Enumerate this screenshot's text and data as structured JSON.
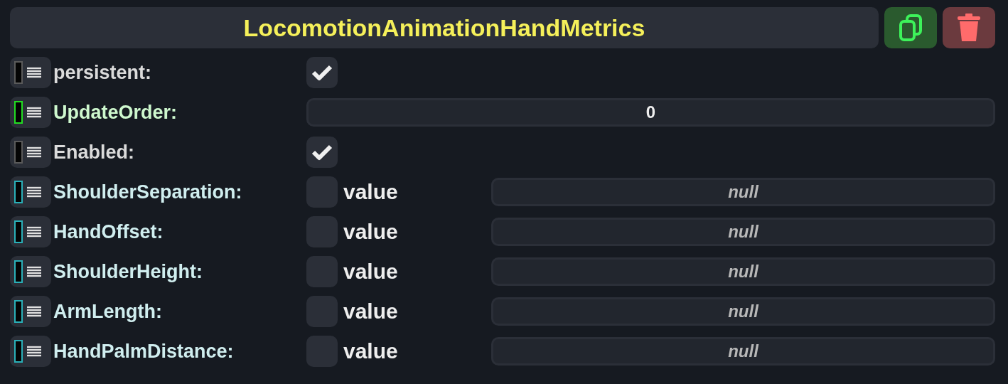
{
  "header": {
    "title": "LocomotionAnimationHandMetrics"
  },
  "fields": [
    {
      "kind": "checkbox",
      "name": "persistent:",
      "color": "#5a5a5a",
      "checked": true
    },
    {
      "kind": "number",
      "name": "UpdateOrder:",
      "color": "#22dd22",
      "value": "0"
    },
    {
      "kind": "checkbox",
      "name": "Enabled:",
      "color": "#5a5a5a",
      "checked": true
    },
    {
      "kind": "nullable",
      "name": "ShoulderSeparation:",
      "color": "#2ab0b8",
      "checked": false,
      "label": "value",
      "value": "null"
    },
    {
      "kind": "nullable",
      "name": "HandOffset:",
      "color": "#2ab0b8",
      "checked": false,
      "label": "value",
      "value": "null"
    },
    {
      "kind": "nullable",
      "name": "ShoulderHeight:",
      "color": "#2ab0b8",
      "checked": false,
      "label": "value",
      "value": "null"
    },
    {
      "kind": "nullable",
      "name": "ArmLength:",
      "color": "#2ab0b8",
      "checked": false,
      "label": "value",
      "value": "null"
    },
    {
      "kind": "nullable",
      "name": "HandPalmDistance:",
      "color": "#2ab0b8",
      "checked": false,
      "label": "value",
      "value": "null"
    }
  ]
}
